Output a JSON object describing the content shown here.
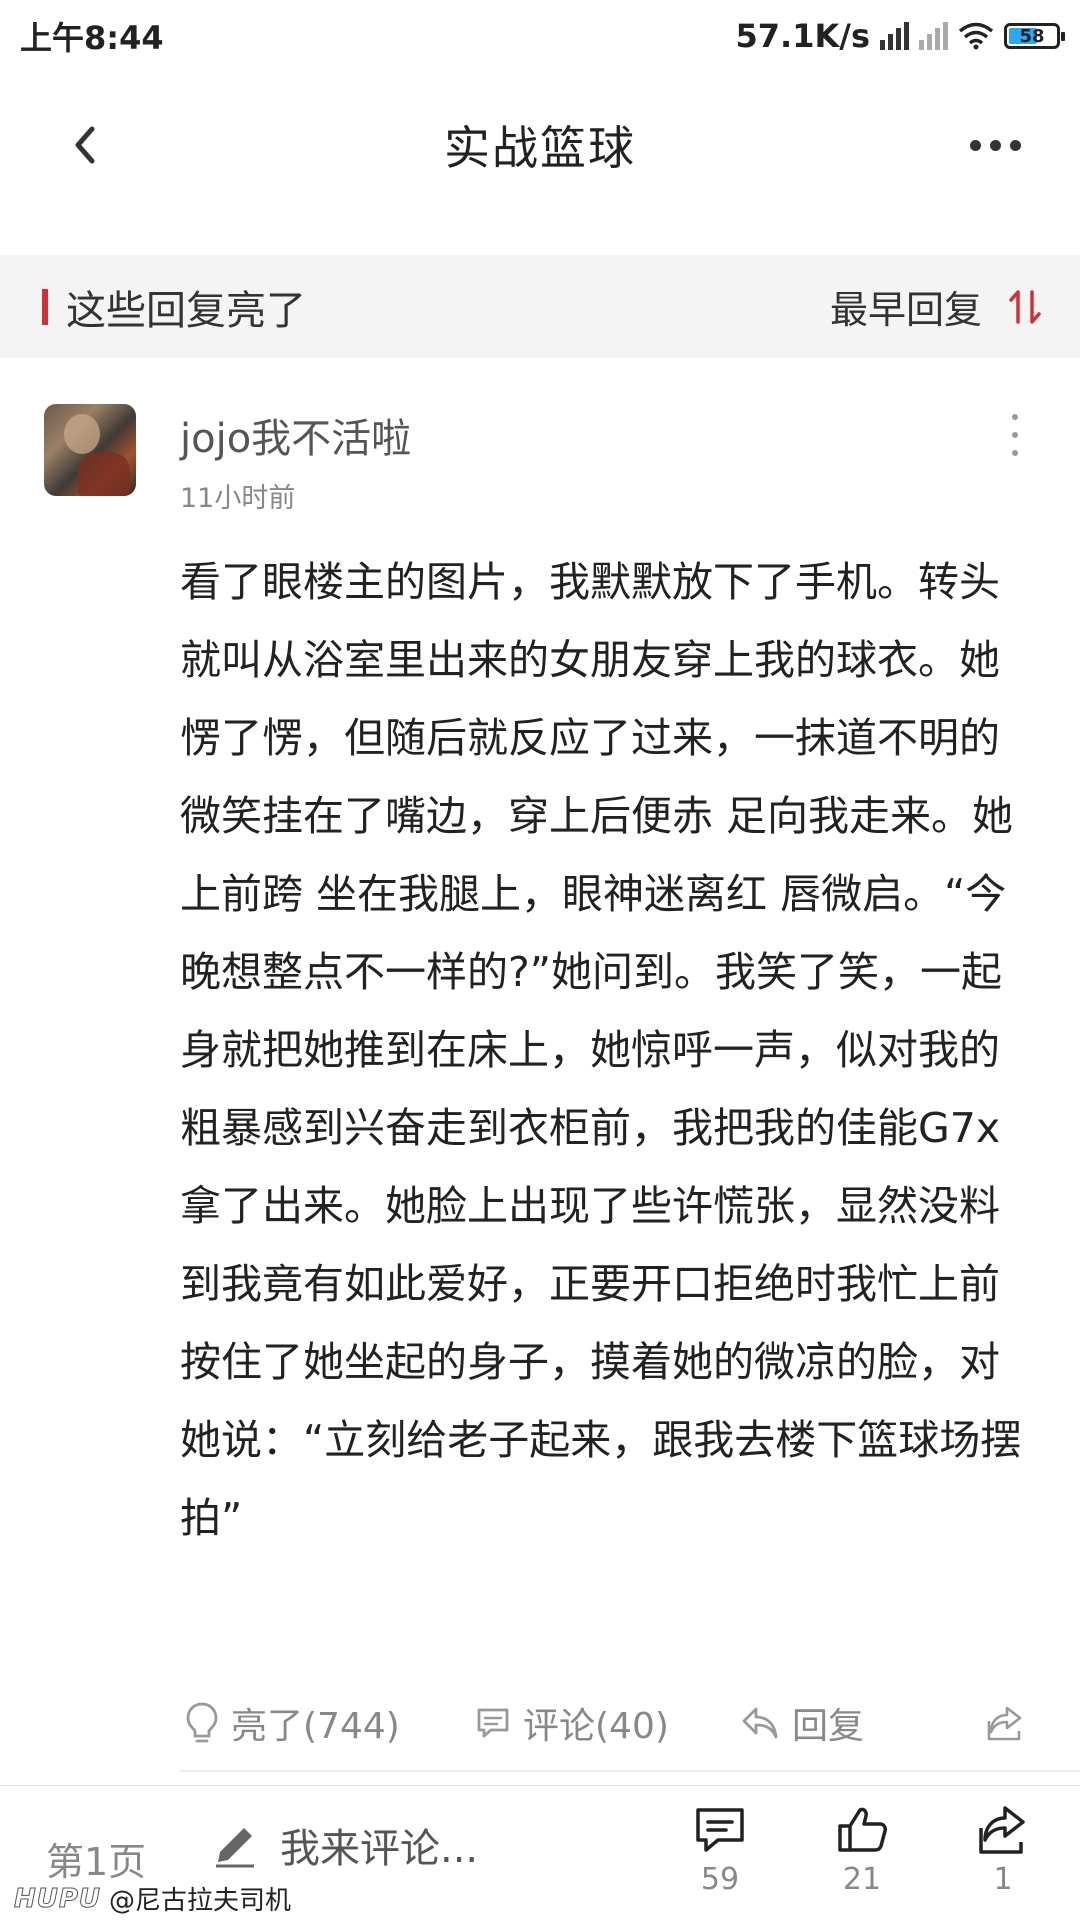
{
  "status_bar": {
    "time": "上午8:44",
    "net_speed": "57.1K/s",
    "battery": "58",
    "battery_color": "#2aa8f2"
  },
  "nav": {
    "title": "实战篮球",
    "back_icon": "chevron-left-icon",
    "more_icon": "more-horizontal-icon"
  },
  "section": {
    "title": "这些回复亮了",
    "sort_label": "最早回复",
    "accent": "#d0303a"
  },
  "post": {
    "username": "jojo我不活啦",
    "time": "11小时前",
    "body": "看了眼楼主的图片，我默默放下了手机。转头就叫从浴室里出来的女朋友穿上我的球衣。她愣了愣，但随后就反应了过来，一抹道不明的微笑挂在了嘴边，穿上后便赤 足向我走来。她上前跨 坐在我腿上，眼神迷离红 唇微启。“今晚想整点不一样的?”她问到。我笑了笑，一起身就把她推到在床上，她惊呼一声，似对我的粗暴感到兴奋走到衣柜前，我把我的佳能G7x拿了出来。她脸上出现了些许慌张，显然没料到我竟有如此爱好，正要开口拒绝时我忙上前按住了她坐起的身子，摸着她的微凉的脸，对她说：“立刻给老子起来，跟我去楼下篮球场摆拍”",
    "actions": {
      "light": "亮了(744)",
      "comment": "评论(40)",
      "reply": "回复"
    }
  },
  "bottom_bar": {
    "page": "第1页",
    "compose_placeholder": "我来评论...",
    "comments_count": "59",
    "likes_count": "21",
    "share_count": "1"
  },
  "watermark": {
    "logo": "HUPU",
    "text": "@尼古拉夫司机"
  }
}
